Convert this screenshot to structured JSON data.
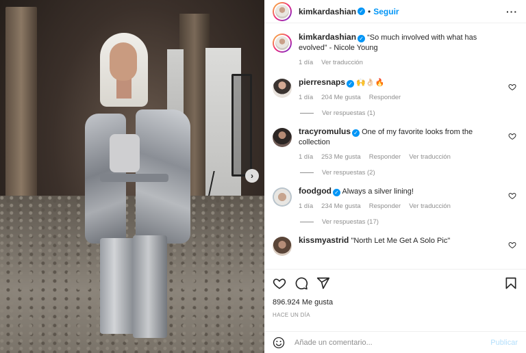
{
  "header": {
    "username": "kimkardashian",
    "separator": "•",
    "follow_label": "Seguir",
    "more_label": "···"
  },
  "media": {
    "next_label": "›"
  },
  "caption": {
    "username": "kimkardashian",
    "text": "“So much involved with what has evolved” - Nicole Young",
    "time": "1 día",
    "translate": "Ver traducción"
  },
  "comments": [
    {
      "username": "pierresnaps",
      "text": "🙌👌🏻🔥",
      "time": "1 día",
      "likes": "204 Me gusta",
      "reply": "Responder",
      "translate": "",
      "replies": "Ver respuestas (1)"
    },
    {
      "username": "tracyromulus",
      "text": "One of my favorite looks from the collection",
      "time": "1 día",
      "likes": "253 Me gusta",
      "reply": "Responder",
      "translate": "Ver traducción",
      "replies": "Ver respuestas (2)"
    },
    {
      "username": "foodgod",
      "text": "Always a silver lining!",
      "time": "1 día",
      "likes": "234 Me gusta",
      "reply": "Responder",
      "translate": "Ver traducción",
      "replies": "Ver respuestas (17)"
    },
    {
      "username": "kissmyastrid",
      "text": "\"North Let Me Get A Solo Pic\"",
      "time": "",
      "likes": "",
      "reply": "",
      "translate": "",
      "replies": ""
    }
  ],
  "actions": {
    "likes": "896.924 Me gusta",
    "ago": "HACE UN DÍA"
  },
  "add_comment": {
    "placeholder": "Añade un comentario...",
    "publish": "Publicar"
  }
}
